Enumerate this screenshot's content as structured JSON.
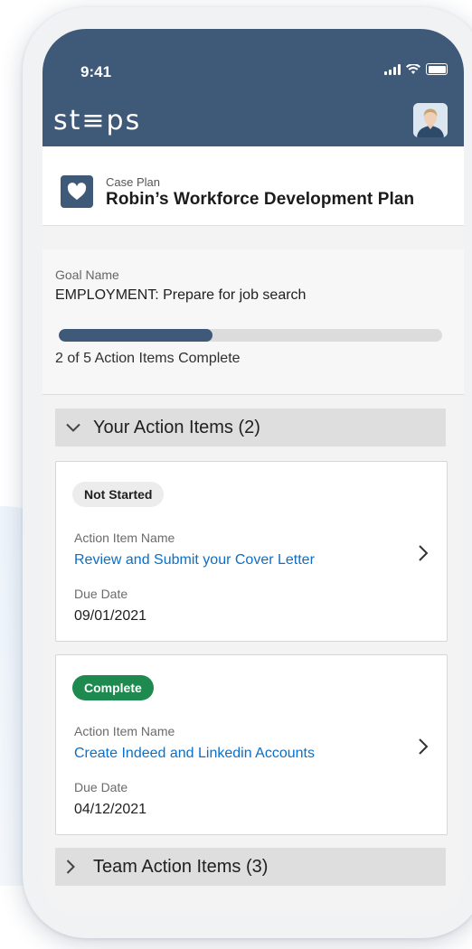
{
  "status_bar": {
    "time": "9:41",
    "icons": [
      "signal-icon",
      "wifi-icon",
      "battery-icon"
    ]
  },
  "app": {
    "logo": "st≡ps"
  },
  "case_plan": {
    "label": "Case Plan",
    "title": "Robin’s Workforce Development Plan"
  },
  "goal": {
    "label": "Goal Name",
    "name": "EMPLOYMENT: Prepare for job search",
    "progress_fraction": 0.4,
    "progress_text": "2 of 5 Action Items Complete"
  },
  "your_items": {
    "header": "Your Action Items (2)",
    "items": [
      {
        "status": "Not Started",
        "name_label": "Action Item Name",
        "name": "Review and Submit your Cover Letter",
        "due_label": "Due Date",
        "due_date": "09/01/2021"
      },
      {
        "status": "Complete",
        "name_label": "Action Item Name",
        "name": "Create Indeed and Linkedin Accounts",
        "due_label": "Due Date",
        "due_date": "04/12/2021"
      }
    ]
  },
  "team_items": {
    "header": "Team Action Items (3)"
  },
  "colors": {
    "header_bg": "#3f5978",
    "link": "#0a6fc8",
    "complete_badge": "#1e8a4f",
    "progress_fill": "#3f5978"
  }
}
